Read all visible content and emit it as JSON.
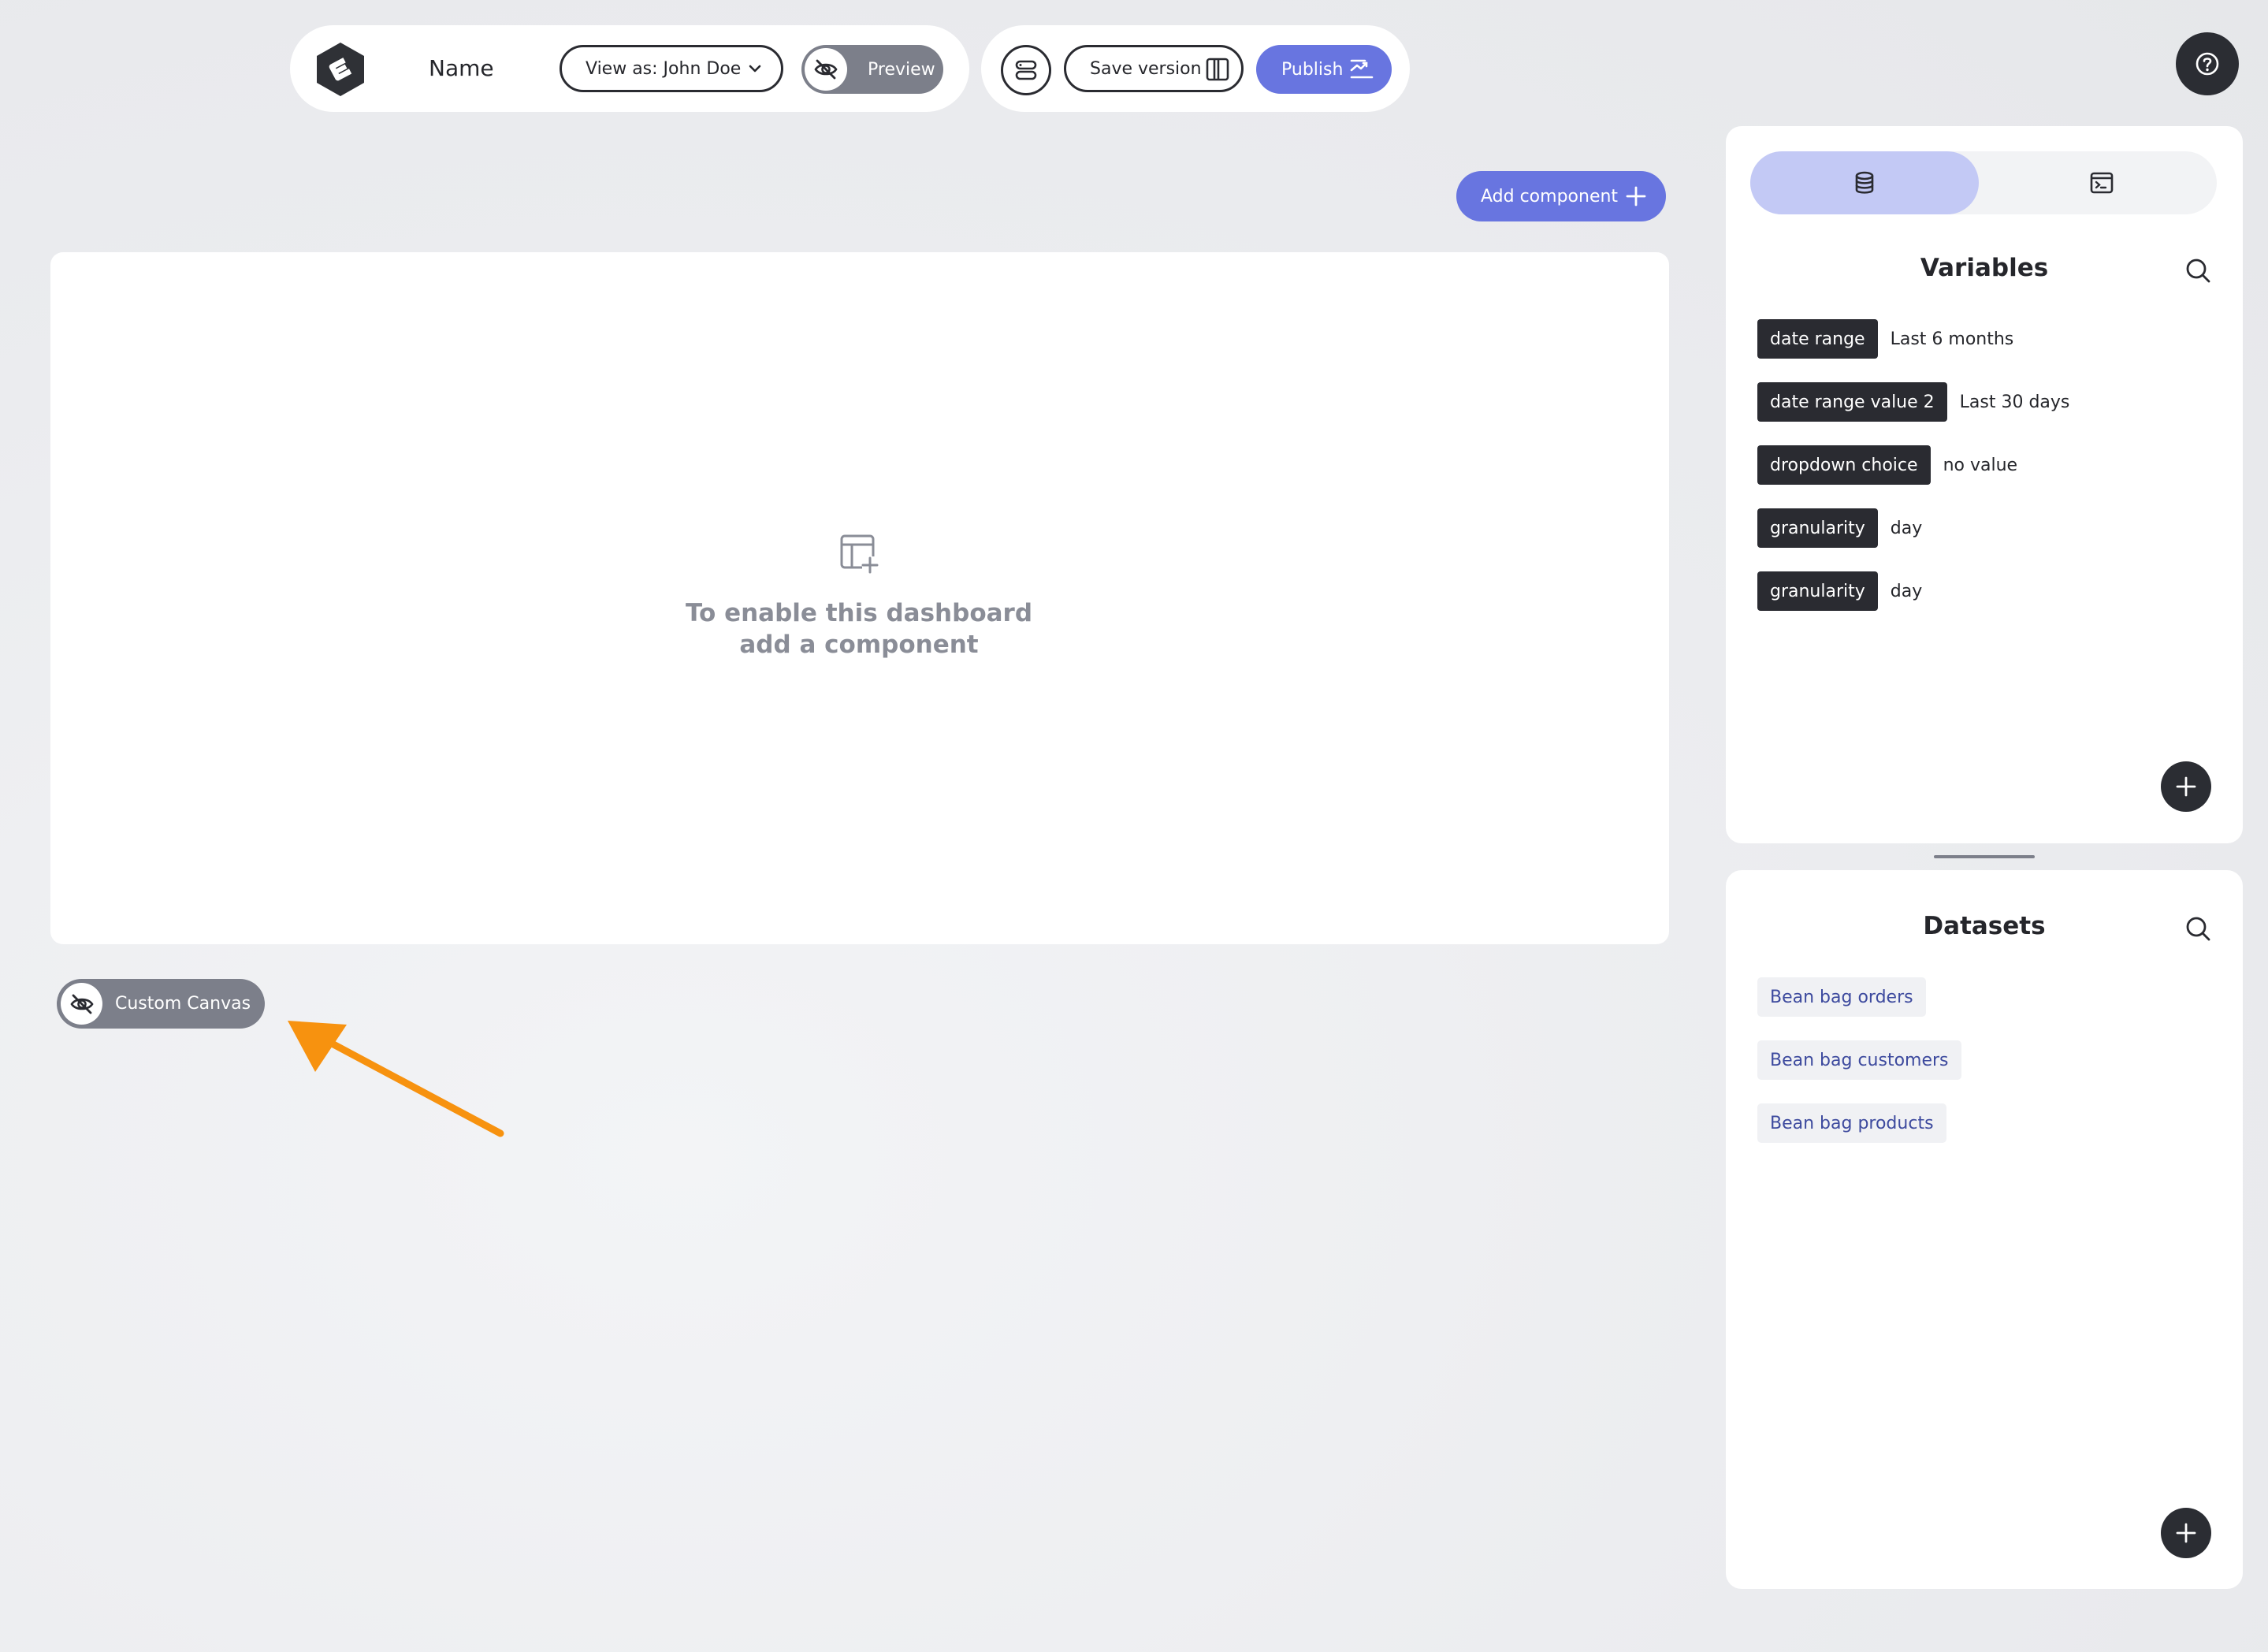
{
  "toolbar": {
    "name_label": "Name",
    "view_as": "View as: John Doe",
    "preview_label": "Preview",
    "save_label": "Save version",
    "publish_label": "Publish"
  },
  "canvas": {
    "add_component_label": "Add component",
    "empty_line1": "To enable this dashboard",
    "empty_line2": "add a component",
    "custom_canvas_label": "Custom Canvas"
  },
  "variables": {
    "title": "Variables",
    "items": [
      {
        "name": "date range",
        "value": "Last 6 months"
      },
      {
        "name": "date range value 2",
        "value": "Last 30 days"
      },
      {
        "name": "dropdown choice",
        "value": "no value"
      },
      {
        "name": "granularity",
        "value": "day"
      },
      {
        "name": "granularity",
        "value": "day"
      }
    ]
  },
  "datasets": {
    "title": "Datasets",
    "items": [
      "Bean bag orders",
      "Bean bag customers",
      "Bean bag products"
    ]
  },
  "colors": {
    "accent": "#6875e0",
    "dark": "#2b2d33",
    "annotation_arrow": "#f7920f"
  },
  "icons": [
    "logo-icon",
    "chevron-down-icon",
    "eye-off-icon",
    "database-toggle-icon",
    "columns-icon",
    "publish-icon",
    "help-icon",
    "plus-icon",
    "add-table-icon",
    "database-icon",
    "terminal-icon",
    "search-icon"
  ]
}
